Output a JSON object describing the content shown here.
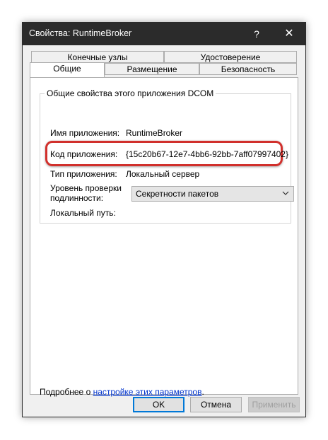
{
  "window": {
    "title": "Свойства: RuntimeBroker",
    "help": "?",
    "close": "✕"
  },
  "tabs": {
    "row1": [
      "Конечные узлы",
      "Удостоверение"
    ],
    "row2": [
      "Общие",
      "Размещение",
      "Безопасность"
    ],
    "active": "Общие"
  },
  "group": {
    "title": "Общие свойства этого приложения DCOM",
    "app_name_label": "Имя приложения:",
    "app_name_value": "RuntimeBroker",
    "app_id_label": "Код приложения:",
    "app_id_value": "{15c20b67-12e7-4bb6-92bb-7aff07997402}",
    "app_type_label": "Тип приложения:",
    "app_type_value": "Локальный сервер",
    "auth_label_1": "Уровень проверки",
    "auth_label_2": "подлинности:",
    "auth_value": "Секретности пакетов",
    "local_path_label": "Локальный путь:"
  },
  "more": {
    "prefix": "Подробнее о ",
    "link": "настройке этих параметров",
    "suffix": "."
  },
  "buttons": {
    "ok": "OK",
    "cancel": "Отмена",
    "apply": "Применить"
  },
  "colors": {
    "titlebar": "#2b2b2b",
    "highlight": "#d1302c",
    "link": "#0033cc",
    "focus": "#0078d7"
  }
}
